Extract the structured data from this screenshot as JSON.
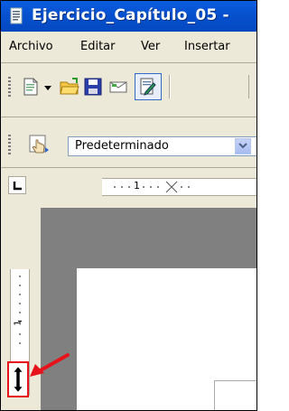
{
  "window": {
    "title": "Ejercicio_Capítulo_05 -"
  },
  "menu": {
    "items": [
      "Archivo",
      "Editar",
      "Ver",
      "Insertar"
    ]
  },
  "toolbar_format": {
    "style_value": "Predeterminado"
  },
  "ruler": {
    "h_label": "1",
    "v_label": "1"
  },
  "icons": [
    "writer-doc-icon",
    "new-document-icon",
    "dropdown-arrow-icon",
    "open-folder-icon",
    "save-icon",
    "email-icon",
    "edit-file-icon",
    "styles-hand-icon",
    "chevron-down-icon",
    "tab-stop-left-icon",
    "row-resize-cursor-icon",
    "red-arrow-icon"
  ]
}
